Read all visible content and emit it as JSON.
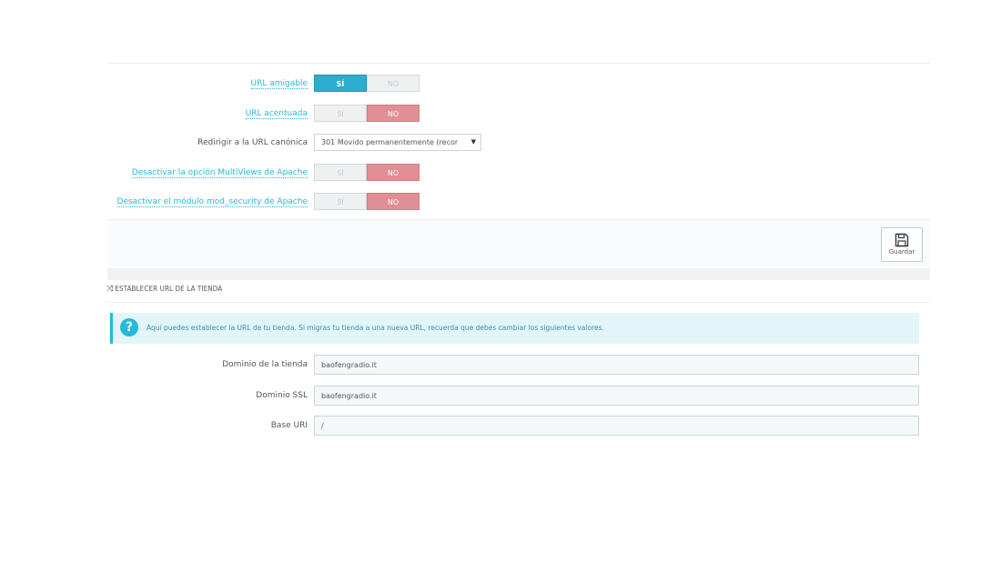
{
  "settings": {
    "url_amigable": {
      "label": "URL amigable",
      "yes": "SÍ",
      "no": "NO",
      "selected": "yes"
    },
    "url_acentuada": {
      "label": "URL acentuada",
      "yes": "SÍ",
      "no": "NO",
      "selected": "no"
    },
    "redirigir": {
      "label": "Redirigir a la URL canónica",
      "value": "301 Movido permanentemente (recor"
    },
    "multiviews": {
      "label": "Desactivar la opción MultiViews de Apache",
      "yes": "SÍ",
      "no": "NO",
      "selected": "no"
    },
    "mod_security": {
      "label": "Desactivar el módulo mod_security de Apache",
      "yes": "SÍ",
      "no": "NO",
      "selected": "no"
    }
  },
  "save": {
    "label": "Guardar"
  },
  "section": {
    "title": "ESTABLECER URL DE LA TIENDA",
    "alert": "Aquí puedes establecer la URL de tu tienda. Si migras tu tienda a una nueva URL, recuerda que debes cambiar los siguientes valores.",
    "fields": [
      {
        "label": "Dominio de la tienda",
        "value": "baofengradio.it"
      },
      {
        "label": "Dominio SSL",
        "value": "baofengradio.it"
      },
      {
        "label": "Base URI",
        "value": "/"
      }
    ]
  },
  "colors": {
    "accent": "#2eacce",
    "no_active": "#e08f95",
    "info_bg": "#e2f5f9"
  }
}
